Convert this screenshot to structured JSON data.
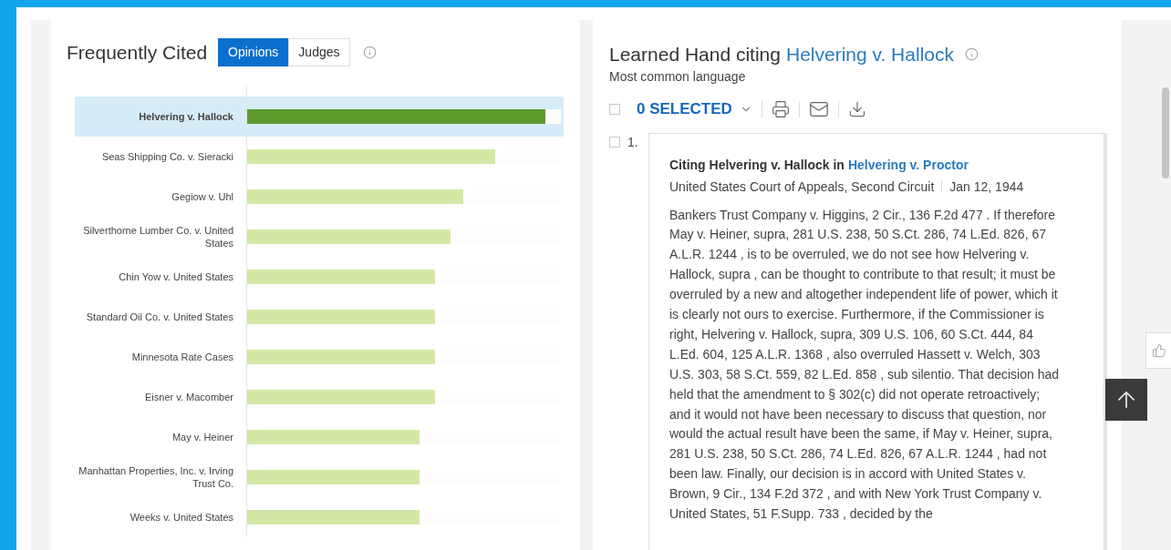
{
  "frequently_cited": {
    "title": "Frequently Cited",
    "tabs": [
      {
        "label": "Opinions",
        "selected": true
      },
      {
        "label": "Judges",
        "selected": false
      }
    ],
    "bars": [
      {
        "label": "Helvering v. Hallock",
        "level": 0.95,
        "selected": true
      },
      {
        "label": "Seas Shipping Co. v. Sieracki",
        "level": 0.79,
        "selected": false
      },
      {
        "label": "Gegiow v. Uhl",
        "level": 0.69,
        "selected": false
      },
      {
        "label": "Silverthorne Lumber Co. v. United States",
        "level": 0.65,
        "selected": false
      },
      {
        "label": "Chin Yow v. United States",
        "level": 0.6,
        "selected": false
      },
      {
        "label": "Standard Oil Co. v. United States",
        "level": 0.6,
        "selected": false
      },
      {
        "label": "Minnesota Rate Cases",
        "level": 0.6,
        "selected": false
      },
      {
        "label": "Eisner v. Macomber",
        "level": 0.6,
        "selected": false
      },
      {
        "label": "May v. Heiner",
        "level": 0.55,
        "selected": false
      },
      {
        "label": "Manhattan Properties, Inc. v. Irving Trust Co.",
        "level": 0.55,
        "selected": false
      },
      {
        "label": "Weeks v. United States",
        "level": 0.55,
        "selected": false
      }
    ]
  },
  "citing": {
    "title": "Learned Hand citing",
    "case_link": "Helvering v. Hallock",
    "subtitle": "Most common language",
    "select_all_checked": false,
    "selected_count": "0 SELECTED",
    "results": [
      {
        "number": "1.",
        "checked": false,
        "heading": "Citing Helvering v. Hallock in",
        "heading_link": "Helvering v. Proctor",
        "court": "United States Court of Appeals, Second Circuit",
        "date": "Jan 12, 1944",
        "excerpt": "Bankers Trust Company v. Higgins, 2 Cir., 136 F.2d 477 . If therefore May v. Heiner, supra, 281 U.S. 238, 50 S.Ct. 286, 74 L.Ed. 826, 67 A.L.R. 1244 , is to be overruled, we do not see how Helvering v. Hallock, supra , can be thought to contribute to that result; it must be overruled by a new and altogether independent life of power, which it is clearly not ours to exercise. Furthermore, if the Commissioner is right, Helvering v. Hallock, supra, 309 U.S. 106, 60 S.Ct. 444, 84 L.Ed. 604, 125 A.L.R. 1368 , also overruled Hassett v. Welch, 303 U.S. 303, 58 S.Ct. 559, 82 L.Ed. 858 , sub silentio. That decision had held that the amendment to § 302(c) did not operate retroactively; and it would not have been necessary to discuss that question, nor would the actual result have been the same, if May v. Heiner, supra, 281 U.S. 238, 50 S.Ct. 286, 74 L.Ed. 826, 67 A.L.R. 1244 , had not been law. Finally, our decision is in accord with United States v. Brown, 9 Cir., 134 F.2d 372 , and with New York Trust Company v. United States, 51 F.Supp. 733 , decided by the"
      }
    ]
  }
}
